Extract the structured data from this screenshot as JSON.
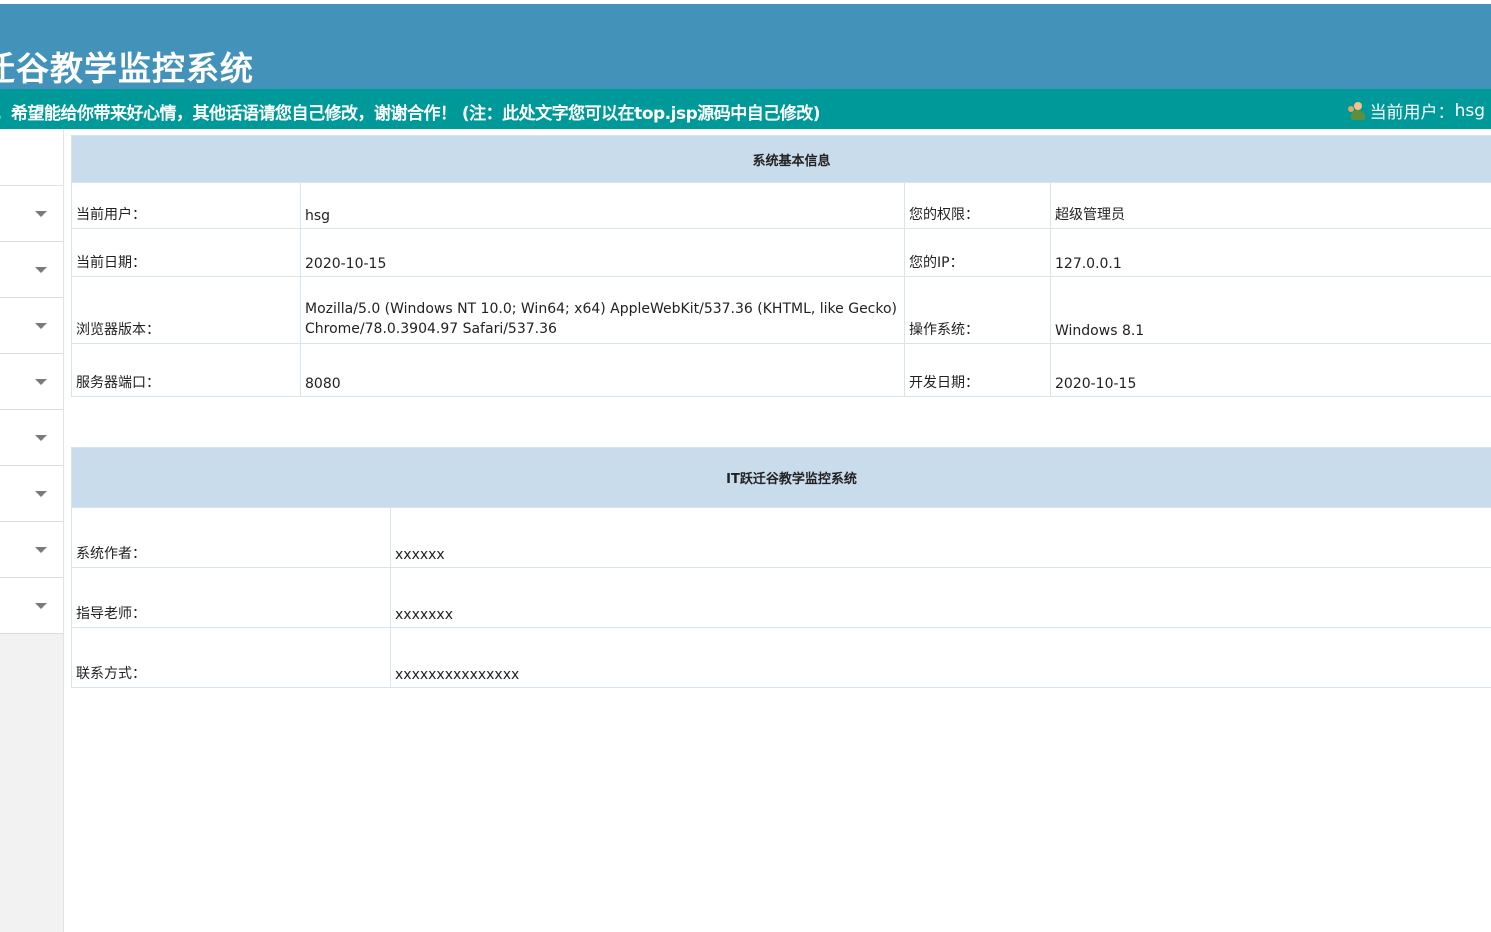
{
  "header": {
    "title": "迁谷教学监控系统"
  },
  "marquee": {
    "text": "站，希望能给你带来好心情，其他话语请您自己修改，谢谢合作！ (注：此处文字您可以在top.jsp源码中自己修改)",
    "current_user_label": "当前用户：",
    "current_user": "hsg"
  },
  "system_info": {
    "title": "系统基本信息",
    "rows": [
      {
        "label1": "当前用户：",
        "value1": "hsg",
        "label2": "您的权限：",
        "value2": "超级管理员"
      },
      {
        "label1": "当前日期：",
        "value1": "2020-10-15",
        "label2": "您的IP：",
        "value2": "127.0.0.1"
      },
      {
        "label1": "浏览器版本：",
        "value1": "Mozilla/5.0 (Windows NT 10.0; Win64; x64) AppleWebKit/537.36 (KHTML, like Gecko) Chrome/78.0.3904.97 Safari/537.36",
        "label2": "操作系统：",
        "value2": "Windows 8.1"
      },
      {
        "label1": "服务器端口：",
        "value1": "8080",
        "label2": "开发日期：",
        "value2": "2020-10-15"
      }
    ]
  },
  "about": {
    "title": "IT跃迁谷教学监控系统",
    "rows": [
      {
        "label": "系统作者：",
        "value": "xxxxxx"
      },
      {
        "label": "指导老师：",
        "value": "xxxxxxx"
      },
      {
        "label": "联系方式：",
        "value": "xxxxxxxxxxxxxxx"
      }
    ]
  }
}
